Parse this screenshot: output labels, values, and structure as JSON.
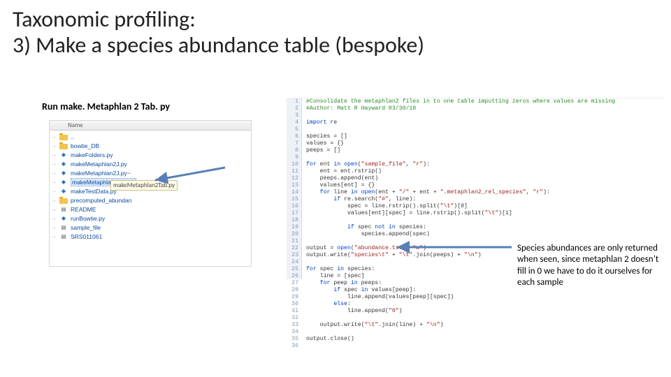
{
  "title": {
    "line1": "Taxonomic profiling:",
    "line2": "3) Make a species abundance table (bespoke)"
  },
  "subhead": "Run make. Metaphlan 2 Tab. py",
  "filebrowser": {
    "header": "Name",
    "items": [
      {
        "icon": "folder",
        "name": ".."
      },
      {
        "icon": "folder",
        "name": "bowtie_DB"
      },
      {
        "icon": "py",
        "name": "makeFolders.py"
      },
      {
        "icon": "py",
        "name": "makeMetaphlan2J.py"
      },
      {
        "icon": "py",
        "name": "makeMetaphlan2J.py~"
      },
      {
        "icon": "py",
        "name": "makeMetaphlan2Tab.py",
        "selected": true
      },
      {
        "icon": "py",
        "name": "makeTestData.py"
      },
      {
        "icon": "folder",
        "name": "precomputed_abundan"
      },
      {
        "icon": "txt",
        "name": "README"
      },
      {
        "icon": "py",
        "name": "runBowtie.py"
      },
      {
        "icon": "txt",
        "name": "sample_file"
      },
      {
        "icon": "txt",
        "name": "SRS011061"
      }
    ],
    "tooltip": "makeMetaphlan2Tab.py"
  },
  "code": {
    "lines": [
      {
        "n": 1,
        "t": "#Consolidate the metaphlan2 files in to one table imputting zeros where values are missing",
        "cls": "c-cmt"
      },
      {
        "n": 2,
        "t": "#Author: Matt R Hayward 03/30/18",
        "cls": "c-cmt"
      },
      {
        "n": 3,
        "t": ""
      },
      {
        "n": 4,
        "t": "import re"
      },
      {
        "n": 5,
        "t": ""
      },
      {
        "n": 6,
        "t": "species = []"
      },
      {
        "n": 7,
        "t": "values = {}"
      },
      {
        "n": 8,
        "t": "peeps = []"
      },
      {
        "n": 9,
        "t": ""
      },
      {
        "n": 10,
        "t": "for ent in open(\"sample_file\", \"r\"):"
      },
      {
        "n": 11,
        "t": "    ent = ent.rstrip()"
      },
      {
        "n": 12,
        "t": "    peeps.append(ent)"
      },
      {
        "n": 13,
        "t": "    values[ent] = {}"
      },
      {
        "n": 14,
        "t": "    for line in open(ent + \"/\" + ent + \".metaphlan2_rel_species\", \"r\"):"
      },
      {
        "n": 15,
        "t": "        if re.search(\"#\", line):"
      },
      {
        "n": 16,
        "t": "            spec = line.rstrip().split(\"\\t\")[0]"
      },
      {
        "n": 17,
        "t": "            values[ent][spec] = line.rstrip().split(\"\\t\")[1]"
      },
      {
        "n": 18,
        "t": ""
      },
      {
        "n": 19,
        "t": "            if spec not in species:"
      },
      {
        "n": 20,
        "t": "                species.append(spec)"
      },
      {
        "n": 21,
        "t": ""
      },
      {
        "n": 22,
        "t": "output = open(\"abundance.tsv\", \"w\")"
      },
      {
        "n": 23,
        "t": "output.write(\"species\\t\" + \"\\t\".join(peeps) + \"\\n\")"
      },
      {
        "n": 24,
        "t": ""
      },
      {
        "n": 25,
        "t": "for spec in species:"
      },
      {
        "n": 26,
        "t": "    line = [spec]"
      },
      {
        "n": 27,
        "t": "    for peep in peeps:"
      },
      {
        "n": 28,
        "t": "        if spec in values[peep]:"
      },
      {
        "n": 29,
        "t": "            line.append(values[peep][spec])"
      },
      {
        "n": 30,
        "t": "        else:"
      },
      {
        "n": 31,
        "t": "            line.append(\"0\")"
      },
      {
        "n": 32,
        "t": ""
      },
      {
        "n": 33,
        "t": "    output.write(\"\\t\".join(line) + \"\\n\")"
      },
      {
        "n": 34,
        "t": ""
      },
      {
        "n": 35,
        "t": "output.close()"
      },
      {
        "n": 36,
        "t": ""
      }
    ]
  },
  "annotation": "Species abundances are only returned when seen, since metaphlan 2 doesn’t fill in 0 we have to do it ourselves for each sample"
}
